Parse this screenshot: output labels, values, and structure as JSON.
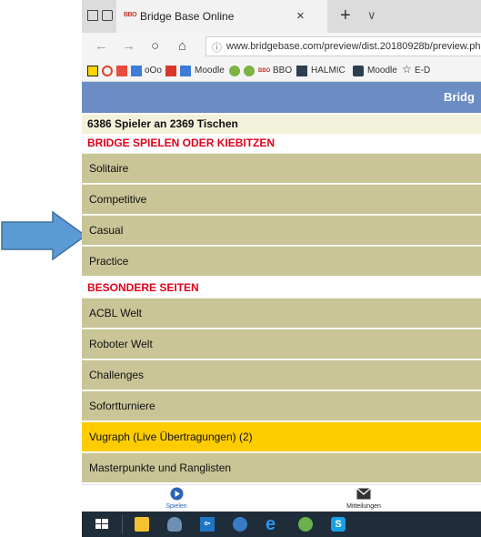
{
  "browser": {
    "tab_title": "Bridge Base Online",
    "tab_favicon": "BBO",
    "close_glyph": "×",
    "new_tab_glyph": "+",
    "tab_menu_glyph": "∨",
    "url": "www.bridgebase.com/preview/dist.20180928b/preview.ph",
    "back_glyph": "←",
    "forward_glyph": "→",
    "refresh_glyph": "○",
    "home_glyph": "⌂",
    "info_glyph": "ⓘ",
    "bookmarks": [
      {
        "label": "oOo",
        "icon": "folder-icon"
      },
      {
        "label": "Moodle",
        "icon": "moodle-icon"
      },
      {
        "label": "BBO",
        "icon": "bbo-icon"
      },
      {
        "label": "HALMIC",
        "icon": "halmic-icon"
      },
      {
        "label": "Moodle",
        "icon": "moodle-icon"
      },
      {
        "label": "E-D",
        "icon": "star-icon"
      }
    ]
  },
  "app": {
    "header_title": "Bridg",
    "players_line": "6386 Spieler an 2369 Tischen",
    "section_play": "BRIDGE SPIELEN ODER KIEBITZEN",
    "play_items": [
      "Solitaire",
      "Competitive",
      "Casual",
      "Practice"
    ],
    "section_special": "BESONDERE SEITEN",
    "special_items": [
      "ACBL Welt",
      "Roboter Welt",
      "Challenges",
      "Sofortturniere",
      "Vugraph (Live Übertragungen) (2)",
      "Masterpunkte und Ranglisten"
    ],
    "nav_play": "Spielen",
    "nav_messages": "Mitteilungen"
  },
  "colors": {
    "header": "#6c8cc4",
    "row": "#c9c597",
    "highlight": "#ffcc00",
    "section_text": "#e0001a",
    "arrow": "#5b9bd5"
  }
}
